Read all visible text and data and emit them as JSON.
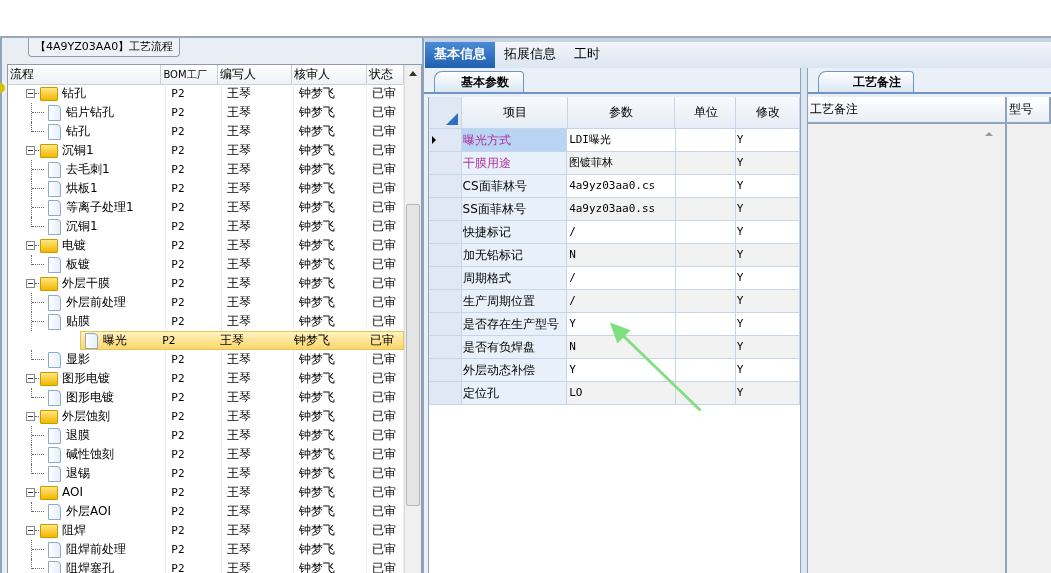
{
  "flow_panel": {
    "title": "【4A9YZ03AA0】工艺流程",
    "columns": [
      "流程",
      "BOM工厂",
      "编写人",
      "核审人",
      "状态"
    ],
    "tree": [
      {
        "name": "钻孔",
        "kind": "folder",
        "expanded": true,
        "selected": false,
        "plant": "P2",
        "author": "王琴",
        "reviewer": "钟梦飞",
        "status": "已审",
        "children": [
          {
            "name": "铝片钻孔",
            "kind": "step",
            "selected": false,
            "plant": "P2",
            "author": "王琴",
            "reviewer": "钟梦飞",
            "status": "已审"
          },
          {
            "name": "钻孔",
            "kind": "step",
            "selected": false,
            "plant": "P2",
            "author": "王琴",
            "reviewer": "钟梦飞",
            "status": "已审"
          }
        ]
      },
      {
        "name": "沉铜1",
        "kind": "folder",
        "expanded": true,
        "selected": false,
        "plant": "P2",
        "author": "王琴",
        "reviewer": "钟梦飞",
        "status": "已审",
        "children": [
          {
            "name": "去毛刺1",
            "kind": "step",
            "selected": false,
            "plant": "P2",
            "author": "王琴",
            "reviewer": "钟梦飞",
            "status": "已审"
          },
          {
            "name": "烘板1",
            "kind": "step",
            "selected": false,
            "plant": "P2",
            "author": "王琴",
            "reviewer": "钟梦飞",
            "status": "已审"
          },
          {
            "name": "等离子处理1",
            "kind": "step",
            "selected": false,
            "plant": "P2",
            "author": "王琴",
            "reviewer": "钟梦飞",
            "status": "已审"
          },
          {
            "name": "沉铜1",
            "kind": "step",
            "selected": false,
            "plant": "P2",
            "author": "王琴",
            "reviewer": "钟梦飞",
            "status": "已审"
          }
        ]
      },
      {
        "name": "电镀",
        "kind": "folder",
        "expanded": true,
        "selected": false,
        "plant": "P2",
        "author": "王琴",
        "reviewer": "钟梦飞",
        "status": "已审",
        "children": [
          {
            "name": "板镀",
            "kind": "step",
            "selected": false,
            "plant": "P2",
            "author": "王琴",
            "reviewer": "钟梦飞",
            "status": "已审"
          }
        ]
      },
      {
        "name": "外层干膜",
        "kind": "folder",
        "expanded": true,
        "selected": false,
        "plant": "P2",
        "author": "王琴",
        "reviewer": "钟梦飞",
        "status": "已审",
        "children": [
          {
            "name": "外层前处理",
            "kind": "step",
            "selected": false,
            "plant": "P2",
            "author": "王琴",
            "reviewer": "钟梦飞",
            "status": "已审"
          },
          {
            "name": "贴膜",
            "kind": "step",
            "selected": false,
            "plant": "P2",
            "author": "王琴",
            "reviewer": "钟梦飞",
            "status": "已审"
          },
          {
            "name": "曝光",
            "kind": "step",
            "selected": true,
            "plant": "P2",
            "author": "王琴",
            "reviewer": "钟梦飞",
            "status": "已审"
          },
          {
            "name": "显影",
            "kind": "step",
            "selected": false,
            "plant": "P2",
            "author": "王琴",
            "reviewer": "钟梦飞",
            "status": "已审"
          }
        ]
      },
      {
        "name": "图形电镀",
        "kind": "folder",
        "expanded": true,
        "selected": false,
        "plant": "P2",
        "author": "王琴",
        "reviewer": "钟梦飞",
        "status": "已审",
        "children": [
          {
            "name": "图形电镀",
            "kind": "step",
            "selected": false,
            "plant": "P2",
            "author": "王琴",
            "reviewer": "钟梦飞",
            "status": "已审"
          }
        ]
      },
      {
        "name": "外层蚀刻",
        "kind": "folder",
        "expanded": true,
        "selected": false,
        "plant": "P2",
        "author": "王琴",
        "reviewer": "钟梦飞",
        "status": "已审",
        "children": [
          {
            "name": "退膜",
            "kind": "step",
            "selected": false,
            "plant": "P2",
            "author": "王琴",
            "reviewer": "钟梦飞",
            "status": "已审"
          },
          {
            "name": "碱性蚀刻",
            "kind": "step",
            "selected": false,
            "plant": "P2",
            "author": "王琴",
            "reviewer": "钟梦飞",
            "status": "已审"
          },
          {
            "name": "退锡",
            "kind": "step",
            "selected": false,
            "plant": "P2",
            "author": "王琴",
            "reviewer": "钟梦飞",
            "status": "已审"
          }
        ]
      },
      {
        "name": "AOI",
        "kind": "folder",
        "expanded": true,
        "selected": false,
        "plant": "P2",
        "author": "王琴",
        "reviewer": "钟梦飞",
        "status": "已审",
        "children": [
          {
            "name": "外层AOI",
            "kind": "step",
            "selected": false,
            "plant": "P2",
            "author": "王琴",
            "reviewer": "钟梦飞",
            "status": "已审"
          }
        ]
      },
      {
        "name": "阻焊",
        "kind": "folder",
        "expanded": true,
        "selected": false,
        "plant": "P2",
        "author": "王琴",
        "reviewer": "钟梦飞",
        "status": "已审",
        "children": [
          {
            "name": "阻焊前处理",
            "kind": "step",
            "selected": false,
            "plant": "P2",
            "author": "王琴",
            "reviewer": "钟梦飞",
            "status": "已审"
          },
          {
            "name": "阻焊塞孔",
            "kind": "step",
            "selected": false,
            "plant": "P2",
            "author": "王琴",
            "reviewer": "钟梦飞",
            "status": "已审"
          }
        ]
      }
    ]
  },
  "info_panel": {
    "tabs": [
      {
        "label": "基本信息",
        "selected": true
      },
      {
        "label": "拓展信息",
        "selected": false
      },
      {
        "label": "工时",
        "selected": false
      }
    ],
    "subtab": "基本参数",
    "columns": [
      "项目",
      "参数",
      "单位",
      "修改"
    ],
    "rows": [
      {
        "item": "曝光方式",
        "value": "LDI曝光",
        "modified": "Y",
        "highlighted": true,
        "selected": true
      },
      {
        "item": "干膜用途",
        "value": "图镀菲林",
        "modified": "Y",
        "highlighted": true,
        "selected": false
      },
      {
        "item": "CS面菲林号",
        "value": "4a9yz03aa0.cs",
        "modified": "Y",
        "highlighted": false,
        "selected": false
      },
      {
        "item": "SS面菲林号",
        "value": "4a9yz03aa0.ss",
        "modified": "Y",
        "highlighted": false,
        "selected": false
      },
      {
        "item": "快捷标记",
        "value": "/",
        "modified": "Y",
        "highlighted": false,
        "selected": false
      },
      {
        "item": "加无铅标记",
        "value": "N",
        "modified": "Y",
        "highlighted": false,
        "selected": false
      },
      {
        "item": "周期格式",
        "value": "/",
        "modified": "Y",
        "highlighted": false,
        "selected": false
      },
      {
        "item": "生产周期位置",
        "value": "/",
        "modified": "Y",
        "highlighted": false,
        "selected": false
      },
      {
        "item": "是否存在生产型号",
        "value": "Y",
        "modified": "Y",
        "highlighted": false,
        "selected": false
      },
      {
        "item": "是否有负焊盘",
        "value": "N",
        "modified": "Y",
        "highlighted": false,
        "selected": false
      },
      {
        "item": "外层动态补偿",
        "value": "Y",
        "modified": "Y",
        "highlighted": false,
        "selected": false
      },
      {
        "item": "定位孔",
        "value": "LO",
        "modified": "Y",
        "highlighted": false,
        "selected": false
      }
    ]
  },
  "notes_panel": {
    "tab": "工艺备注",
    "columns": [
      "工艺备注",
      "型号"
    ]
  }
}
